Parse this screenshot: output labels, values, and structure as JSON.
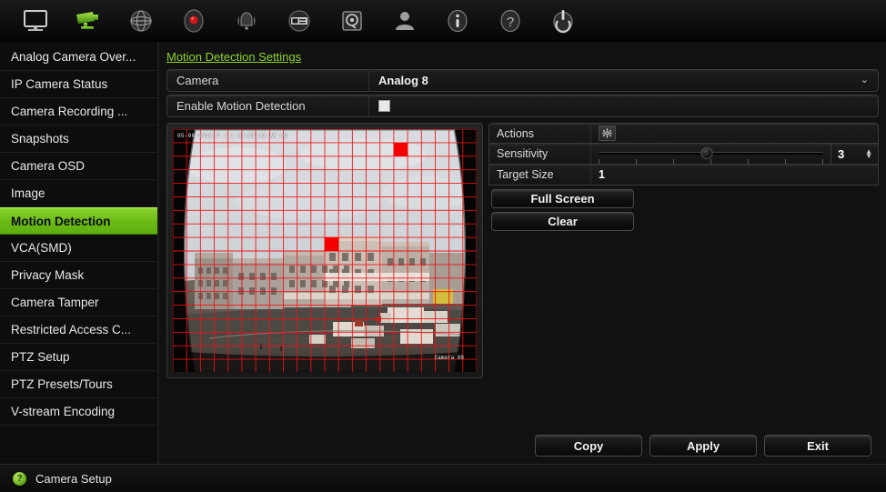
{
  "toolbar": {
    "items": [
      {
        "name": "monitor-icon",
        "label": "Display"
      },
      {
        "name": "camera-icon",
        "label": "Camera Setup"
      },
      {
        "name": "network-icon",
        "label": "Network Setup"
      },
      {
        "name": "record-icon",
        "label": "Recording Setup"
      },
      {
        "name": "alarm-icon",
        "label": "Alarm Setup"
      },
      {
        "name": "pos-icon",
        "label": "POS Setup"
      },
      {
        "name": "hdd-icon",
        "label": "Storage Setup"
      },
      {
        "name": "user-icon",
        "label": "User Management"
      },
      {
        "name": "info-icon",
        "label": "System Information"
      },
      {
        "name": "help-icon",
        "label": "Help"
      },
      {
        "name": "power-icon",
        "label": "Shutdown"
      }
    ]
  },
  "sidebar": {
    "items": [
      {
        "label": "Analog Camera Over...",
        "active": false
      },
      {
        "label": "IP Camera Status",
        "active": false
      },
      {
        "label": "Camera Recording ...",
        "active": false
      },
      {
        "label": "Snapshots",
        "active": false
      },
      {
        "label": "Camera OSD",
        "active": false
      },
      {
        "label": "Image",
        "active": false
      },
      {
        "label": "Motion Detection",
        "active": true
      },
      {
        "label": "VCA(SMD)",
        "active": false
      },
      {
        "label": "Privacy Mask",
        "active": false
      },
      {
        "label": "Camera Tamper",
        "active": false
      },
      {
        "label": "Restricted Access C...",
        "active": false
      },
      {
        "label": "PTZ Setup",
        "active": false
      },
      {
        "label": "PTZ Presets/Tours",
        "active": false
      },
      {
        "label": "V-stream Encoding",
        "active": false
      }
    ]
  },
  "main": {
    "page_title": "Motion Detection Settings",
    "camera": {
      "label": "Camera",
      "value": "Analog 8",
      "caret": "⌄"
    },
    "enable_motion": {
      "label": "Enable Motion Detection",
      "checked": false
    },
    "video": {
      "osd_timestamp": "05-06-2015 F r i 07:57:43 AM HD",
      "osd_camera_name": "Camera 08",
      "grid_cols": 22,
      "grid_rows": 18,
      "grid_color": "#ee1111",
      "selected_cells": [
        {
          "col": 16,
          "row": 1,
          "w": 1,
          "h": 1
        },
        {
          "col": 11,
          "row": 8,
          "w": 1,
          "h": 1
        }
      ]
    },
    "actions": {
      "label": "Actions",
      "icon": "gear-icon"
    },
    "sensitivity": {
      "label": "Sensitivity",
      "value": "3",
      "min": 0,
      "max": 6,
      "ticks": 7,
      "handle_percent": 48
    },
    "target_size": {
      "label": "Target Size",
      "value": "1"
    },
    "full_screen_label": "Full Screen",
    "clear_label": "Clear",
    "buttons": {
      "copy": "Copy",
      "apply": "Apply",
      "exit": "Exit"
    }
  },
  "statusbar": {
    "icon": "help-icon",
    "icon_glyph": "?",
    "text": "Camera Setup"
  },
  "colors": {
    "accent_green": "#8cd430",
    "title_green": "#8fd42a",
    "grid_red": "#ee1111",
    "selected_red": "#f50000",
    "panel_bg": "#111111",
    "sidebar_bg": "#0d0d0d"
  }
}
